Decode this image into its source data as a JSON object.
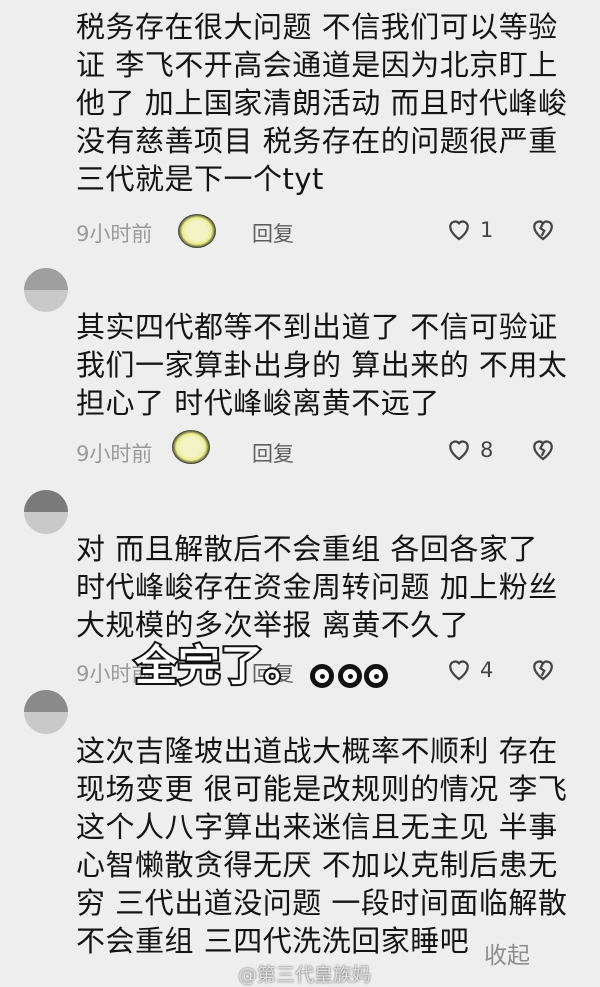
{
  "comments": [
    {
      "text": "税务存在很大问题 不信我们可以等验证 李飞不开高会通道是因为北京盯上他了 加上国家清朗活动 而且时代峰峻没有慈善项目 税务存在的问题很严重 三代就是下一个tyt",
      "time": "9小时前",
      "reply": "回复",
      "likes": "1"
    },
    {
      "text": "其实四代都等不到出道了 不信可验证 我们一家算卦出身的 算出来的 不用太担心了 时代峰峻离黄不远了",
      "time": "9小时前",
      "reply": "回复",
      "likes": "8"
    },
    {
      "text": "对 而且解散后不会重组 各回各家了 时代峰峻存在资金周转问题 加上粉丝大规模的多次举报 离黄不久了",
      "time": "9小时前",
      "reply": "回复",
      "likes": "4"
    },
    {
      "text": "这次吉隆坡出道战大概率不顺利 存在现场变更 很可能是改规则的情况 李飞这个人八字算出来迷信且无主见 半事心智懒散贪得无厌 不加以克制后患无穷 三代出道没问题 一段时间面临解散不会重组 三四代洗洗回家睡吧"
    }
  ],
  "overlay_caption": "全完了。",
  "collapse_label": "收起",
  "watermark": "@第三代皇族妈",
  "icons": [
    "heart-icon",
    "broken-heart-icon",
    "emoji-sticker-icon",
    "avatar"
  ]
}
